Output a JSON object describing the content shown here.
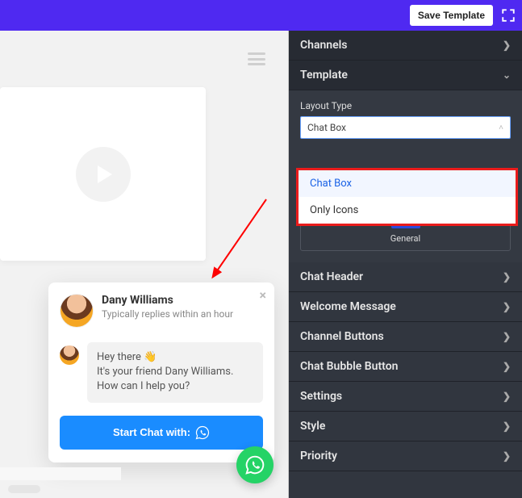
{
  "topbar": {
    "save_label": "Save Template"
  },
  "chat": {
    "name": "Dany Williams",
    "subtitle": "Typically replies within an hour",
    "greeting_line1": "Hey there ",
    "greeting_wave": "👋",
    "greeting_line2": "It's your friend Dany Williams. How can I help you?",
    "start_label": "Start Chat with:"
  },
  "panel": {
    "channels": "Channels",
    "template": "Template",
    "layout_label": "Layout Type",
    "layout_selected": "Chat Box",
    "dd_options": {
      "opt1": "Chat Box",
      "opt2": "Only Icons"
    },
    "thumb_label": "General",
    "sections": {
      "chat_header": "Chat Header",
      "welcome": "Welcome Message",
      "channel_buttons": "Channel Buttons",
      "bubble": "Chat Bubble Button",
      "settings": "Settings",
      "style": "Style",
      "priority": "Priority"
    }
  }
}
